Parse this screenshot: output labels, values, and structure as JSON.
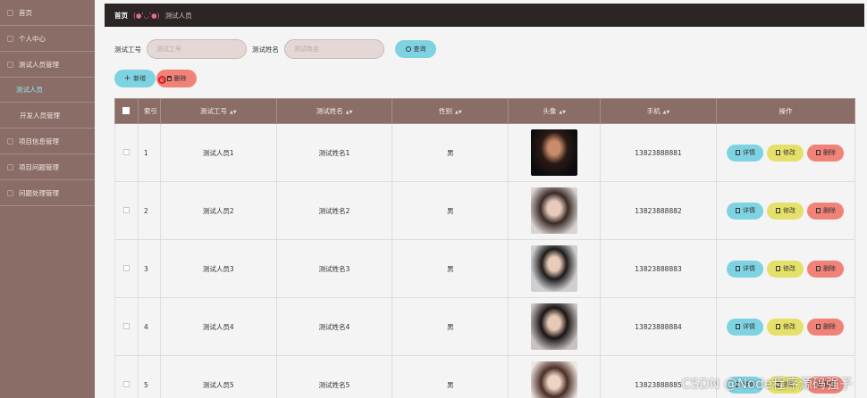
{
  "sidebar": {
    "items": [
      {
        "label": "首页",
        "active": false,
        "sub": false
      },
      {
        "label": "个人中心",
        "active": false,
        "sub": false
      },
      {
        "label": "测试人员管理",
        "active": false,
        "sub": false
      },
      {
        "label": "测试人员",
        "active": true,
        "sub": true
      },
      {
        "label": "开发人员管理",
        "active": false,
        "sub": true
      },
      {
        "label": "项目信息管理",
        "active": false,
        "sub": false
      },
      {
        "label": "项目问题管理",
        "active": false,
        "sub": false
      },
      {
        "label": "问题处理管理",
        "active": false,
        "sub": false
      }
    ]
  },
  "breadcrumb": {
    "home": "首页",
    "separator": "(●'◡'●)",
    "current": "测试人员"
  },
  "search": {
    "field1_label": "测试工号",
    "field1_placeholder": "测试工号",
    "field2_label": "测试姓名",
    "field2_placeholder": "测试姓名",
    "query_label": "查询"
  },
  "actions": {
    "add_label": "新增",
    "delete_label": "删除"
  },
  "table": {
    "columns": [
      "索引",
      "测试工号",
      "测试姓名",
      "性别",
      "头像",
      "手机",
      "操作"
    ],
    "rows": [
      {
        "index": "1",
        "id": "测试人员1",
        "name": "测试姓名1",
        "gender": "男",
        "phone": "13823888881"
      },
      {
        "index": "2",
        "id": "测试人员2",
        "name": "测试姓名2",
        "gender": "男",
        "phone": "13823888882"
      },
      {
        "index": "3",
        "id": "测试人员3",
        "name": "测试姓名3",
        "gender": "男",
        "phone": "13823888883"
      },
      {
        "index": "4",
        "id": "测试人员4",
        "name": "测试姓名4",
        "gender": "男",
        "phone": "13823888884"
      },
      {
        "index": "5",
        "id": "测试人员5",
        "name": "测试姓名5",
        "gender": "男",
        "phone": "13823888885"
      }
    ],
    "row_actions": {
      "detail": "详情",
      "edit": "修改",
      "remove": "删除"
    }
  },
  "watermark": "CSDN @Node程序源码强子",
  "colors": {
    "sidebar": "#8a6d66",
    "topbar": "#2b2524",
    "accent_cyan": "#7ed3e2",
    "accent_yellow": "#e5e06a",
    "accent_red": "#f08278"
  }
}
